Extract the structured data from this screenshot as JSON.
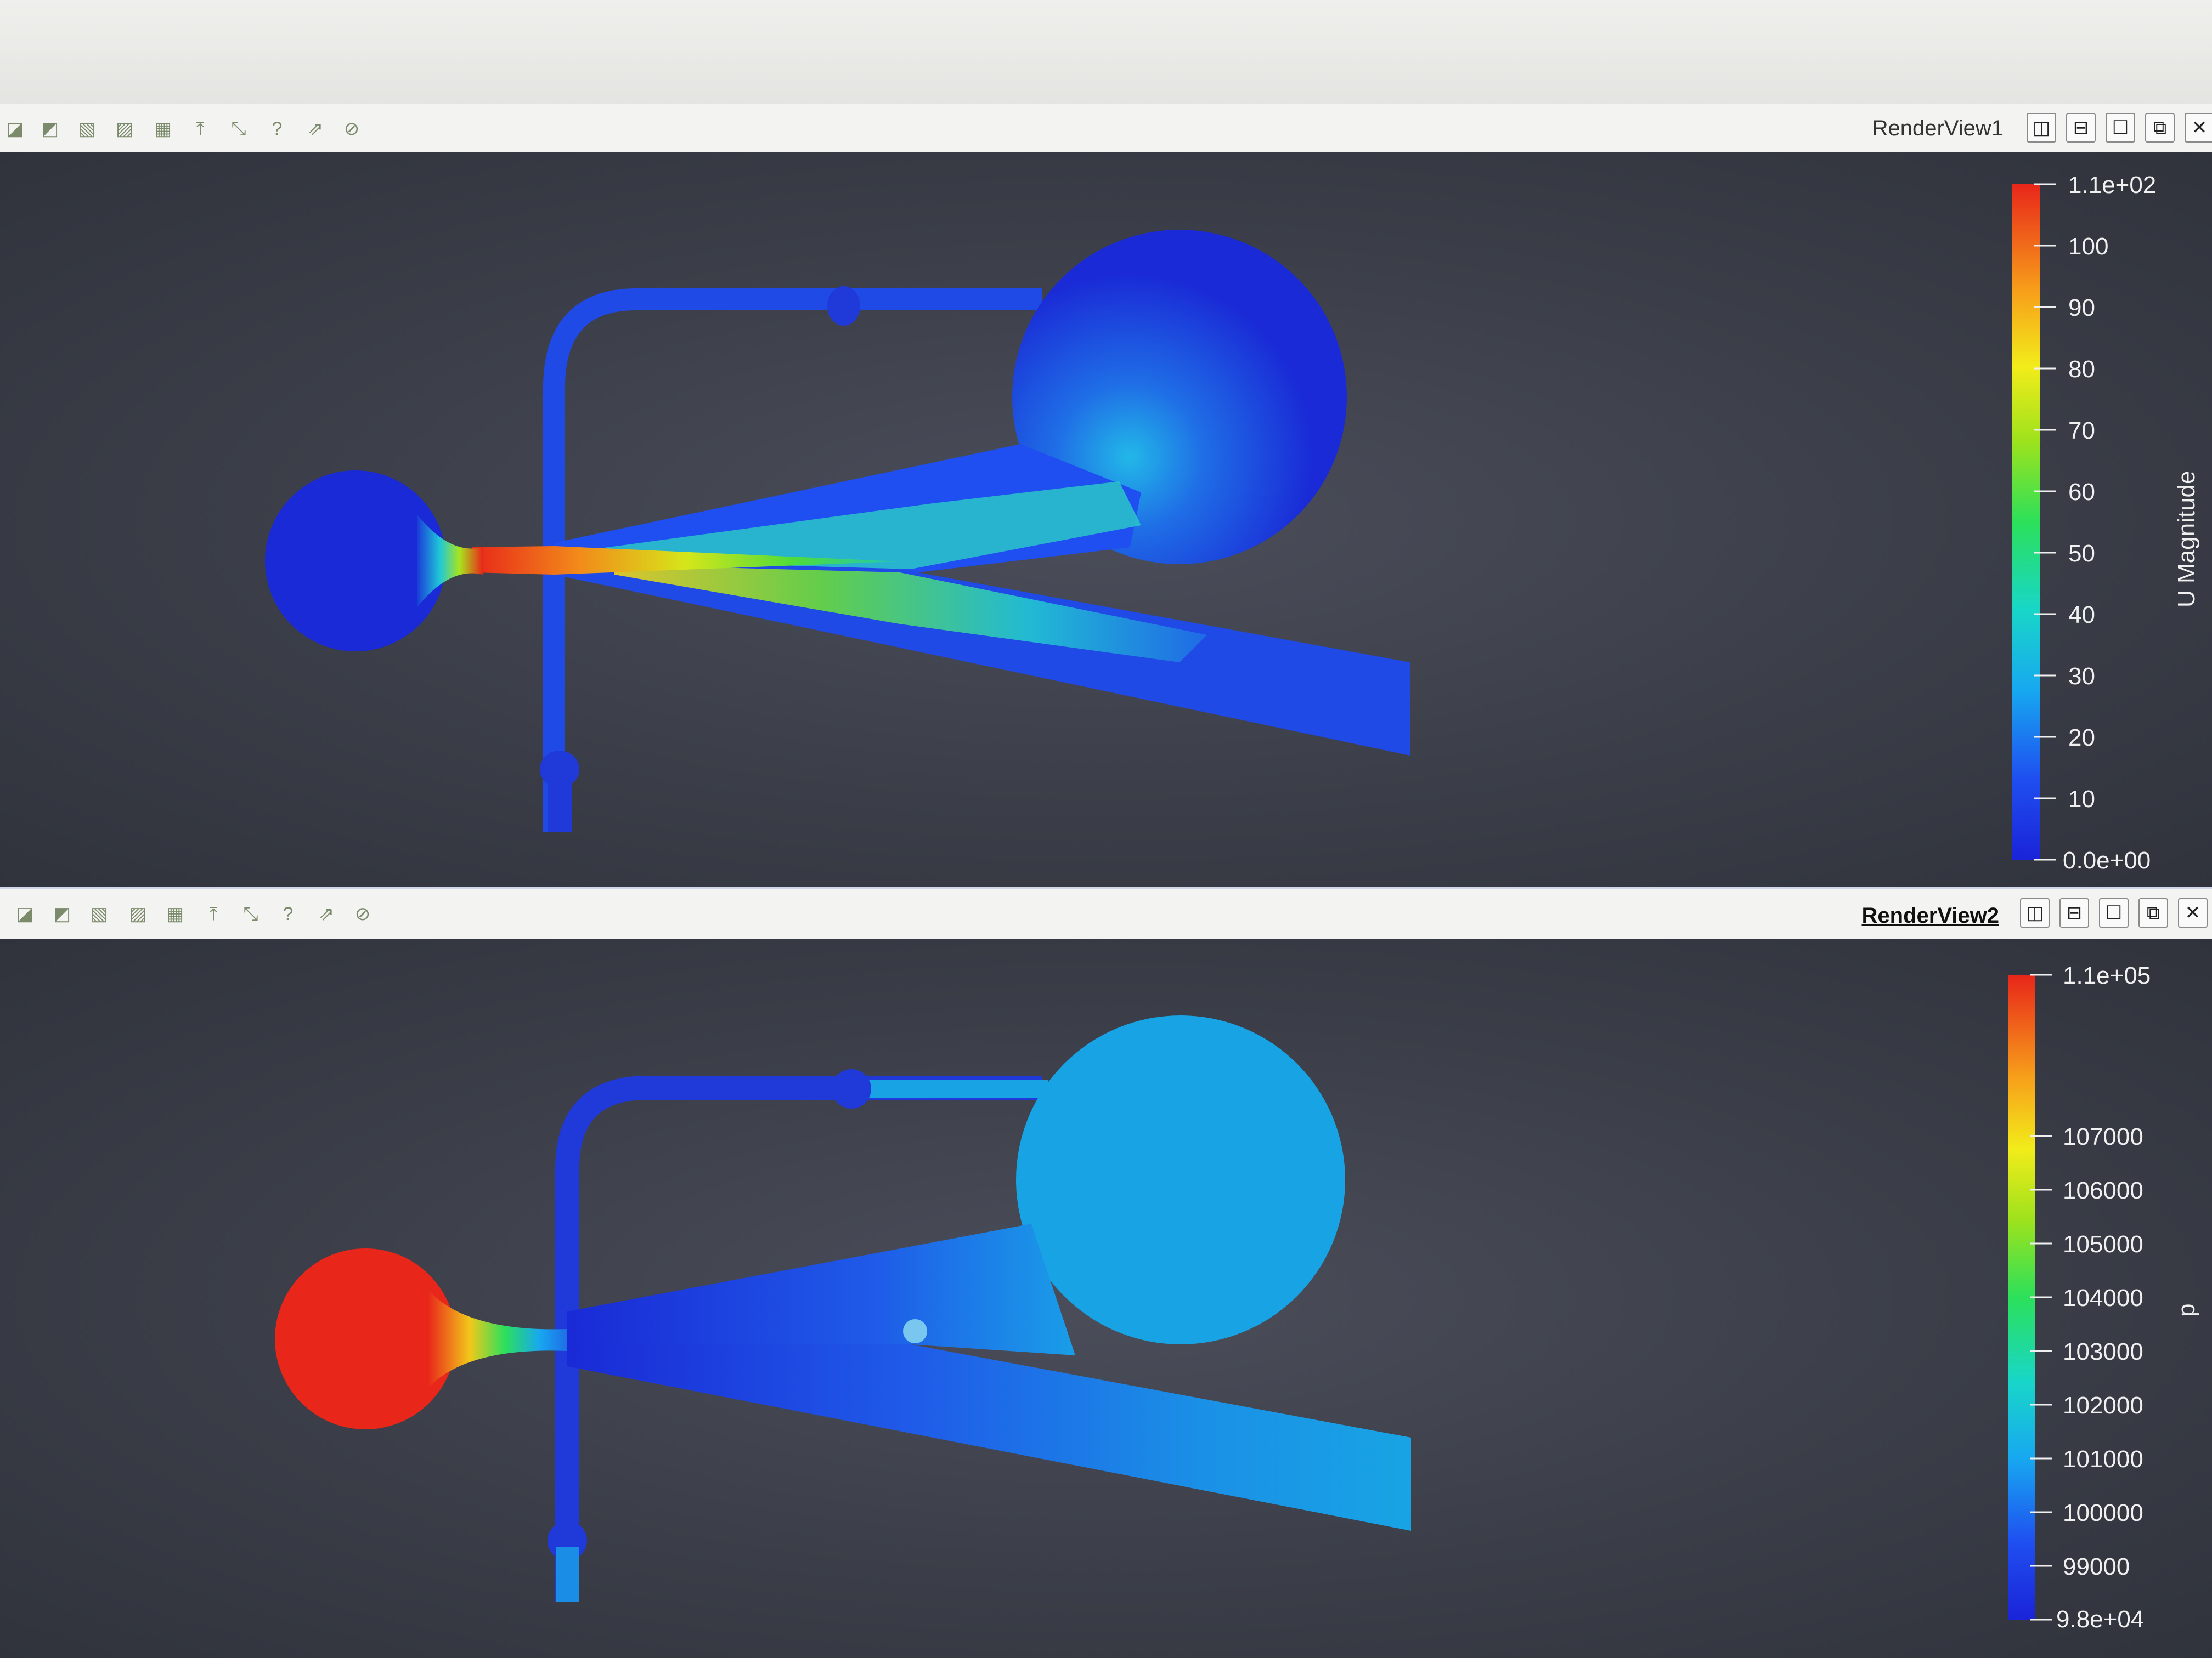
{
  "views": [
    {
      "title": "RenderView1",
      "toolbar_icons": [
        "select-cells-icon",
        "select-points-icon",
        "select-cells-frustum-icon",
        "select-points-frustum-icon",
        "select-block-icon",
        "interactive-select-icon",
        "hover-points-icon",
        "hover-query-icon",
        "pick-icon",
        "clear-selection-icon"
      ],
      "window_buttons": [
        "split-horizontal",
        "split-vertical",
        "maximize",
        "restore",
        "close"
      ],
      "scalar_bar": {
        "title": "U Magnitude",
        "max_label": "1.1e+02",
        "min_label": "0.0e+00",
        "ticks": [
          "100",
          "90",
          "80",
          "70",
          "60",
          "50",
          "40",
          "30",
          "20",
          "10"
        ],
        "range": [
          0,
          110
        ]
      }
    },
    {
      "title": "RenderView2",
      "toolbar_icons": [
        "select-cells-icon",
        "select-points-icon",
        "select-cells-frustum-icon",
        "select-points-frustum-icon",
        "select-block-icon",
        "interactive-select-icon",
        "hover-points-icon",
        "hover-query-icon",
        "pick-icon",
        "clear-selection-icon"
      ],
      "window_buttons": [
        "split-horizontal",
        "split-vertical",
        "maximize",
        "restore",
        "close"
      ],
      "scalar_bar": {
        "title": "p",
        "max_label": "1.1e+05",
        "min_label": "9.8e+04",
        "ticks": [
          "107000",
          "106000",
          "105000",
          "104000",
          "103000",
          "102000",
          "101000",
          "100000",
          "99000"
        ],
        "range": [
          98000,
          110000
        ]
      }
    }
  ],
  "glyphs": {
    "split-horizontal": "◫",
    "split-vertical": "⊟",
    "maximize": "☐",
    "restore": "⧉",
    "close": "✕",
    "tool": [
      "◪",
      "◩",
      "▧",
      "▨",
      "▦",
      "⤒",
      "⤡",
      "?",
      "⇗",
      "⊘"
    ]
  },
  "colors": {
    "jet_low": "#1a23d8",
    "jet_high": "#e8261a",
    "background": "#3b3e48"
  }
}
